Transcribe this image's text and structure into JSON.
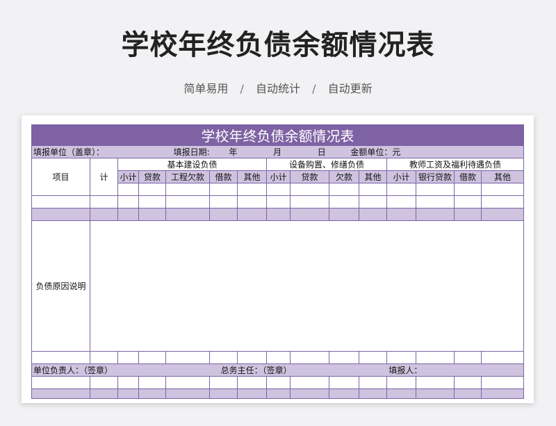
{
  "page": {
    "title": "学校年终负债余额情况表",
    "tagline": [
      "简单易用",
      "自动统计",
      "自动更新"
    ],
    "separator": "/"
  },
  "sheet": {
    "table_title": "学校年终负债余额情况表",
    "info": {
      "unit": "填报单位（盖章）：",
      "date_label": "填报日期:",
      "year": "年",
      "month": "月",
      "day": "日",
      "amount_unit": "金额单位：元"
    },
    "headers": {
      "item": "项目",
      "total": "计",
      "group_construction": "基本建设负债",
      "group_equipment": "设备购置、修缮负债",
      "group_teacher": "教师工资及福利待遇负债",
      "construction_cols": [
        "小计",
        "贷款",
        "工程欠款",
        "借款",
        "其他"
      ],
      "equipment_cols": [
        "小计",
        "贷款",
        "欠款",
        "其他"
      ],
      "teacher_cols": [
        "小计",
        "银行贷款",
        "借款",
        "其他"
      ]
    },
    "reason_label": "负债原因说明",
    "footer": {
      "head": "单位负责人：（签章）",
      "director": "总务主任：（签章）",
      "filler": "填报人："
    }
  },
  "colors": {
    "header_purple": "#7e62a3",
    "lavender": "#cfc3df",
    "border": "#7a63a6"
  }
}
